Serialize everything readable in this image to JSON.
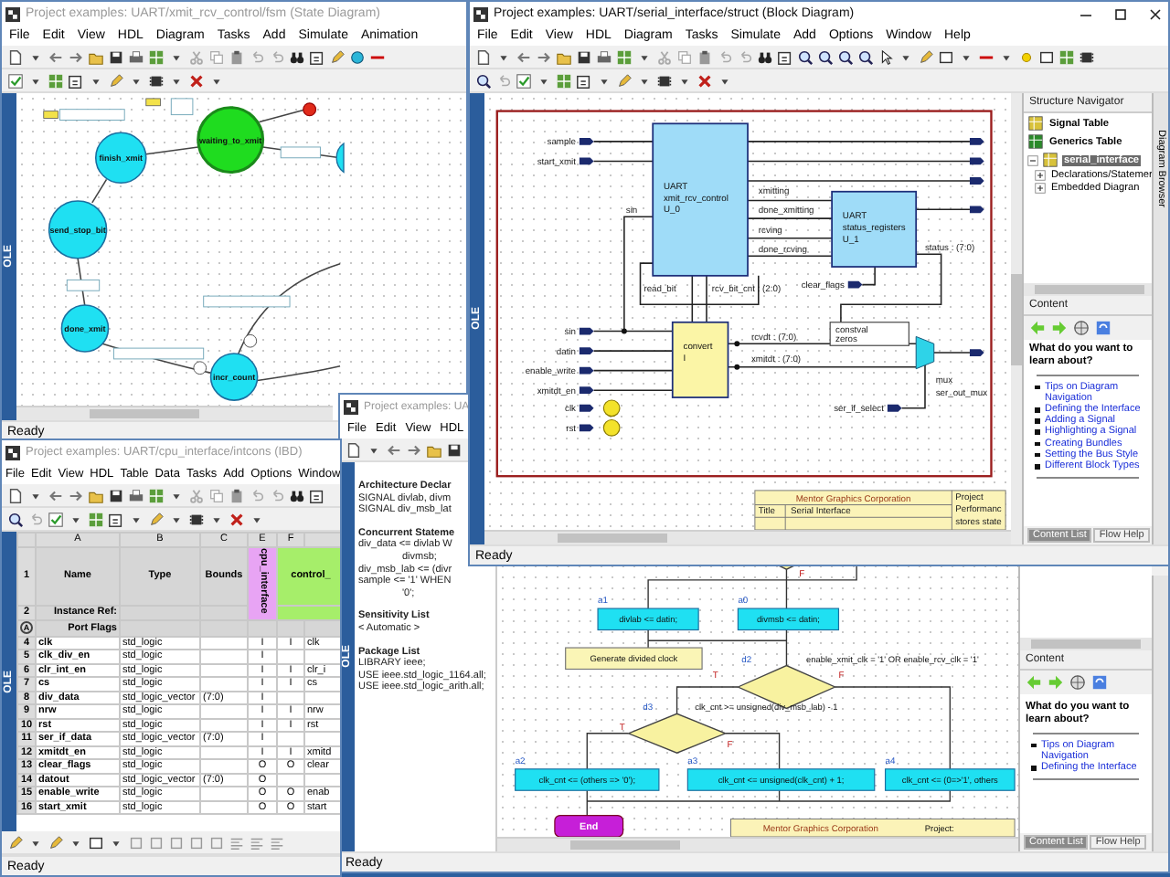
{
  "state_window": {
    "title": "Project examples: UART/xmit_rcv_control/fsm (State Diagram)",
    "menu": [
      "File",
      "Edit",
      "View",
      "HDL",
      "Diagram",
      "Tasks",
      "Add",
      "Simulate",
      "Animation"
    ],
    "side_tab": "OLE",
    "states": [
      {
        "name": "waiting_to_xmit",
        "active": true
      },
      {
        "name": "finish_xmit",
        "active": false
      },
      {
        "name": "send_stop_bit",
        "active": false
      },
      {
        "name": "done_xmit",
        "active": false
      },
      {
        "name": "incr_count",
        "active": false
      }
    ],
    "status": "Ready"
  },
  "block_window": {
    "title": "Project examples: UART/serial_interface/struct (Block Diagram)",
    "menu": [
      "File",
      "Edit",
      "View",
      "HDL",
      "Diagram",
      "Tasks",
      "Simulate",
      "Add",
      "Options",
      "Window",
      "Help"
    ],
    "side_tab": "OLE",
    "ports": [
      "sample",
      "start_xmit",
      "sin",
      "datin",
      "enable_write",
      "xmitdt_en",
      "clk",
      "rst",
      "clear_flags",
      "ser_if_select"
    ],
    "blocks": [
      {
        "kind": "component",
        "lines": [
          "UART",
          "xmit_rcv_control",
          "U_0"
        ]
      },
      {
        "kind": "component",
        "lines": [
          "UART",
          "status_registers",
          "U_1"
        ]
      },
      {
        "kind": "embedded",
        "lines": [
          "convert",
          "I"
        ]
      }
    ],
    "signals": [
      "xmitting",
      "done_xmitting",
      "rcving",
      "done_rcving",
      "sin",
      "read_bit",
      "rcv_bit_cnt : (2:0)",
      "status : (7:0)",
      "rcvdt : (7:0)",
      "xmitdt : (7:0)",
      "mux",
      "ser_out_mux"
    ],
    "constant": [
      "constval",
      "zeros"
    ],
    "title_block": {
      "company": "Mentor Graphics Corporation",
      "title_label": "Title",
      "title": "Serial Interface",
      "project_label": "Project",
      "fields": [
        "Performanc",
        "stores state"
      ]
    },
    "navigator": {
      "title": "Structure Navigator",
      "items": [
        {
          "label": "Signal Table",
          "selected": false
        },
        {
          "label": "Generics Table",
          "selected": false
        },
        {
          "label": "serial_interface",
          "selected": true,
          "children": [
            {
              "label": "Declarations/Statemer"
            },
            {
              "label": "Embedded Diagran"
            }
          ]
        }
      ]
    },
    "browser_tab": "Diagram Browser",
    "help": {
      "title": "Content",
      "question": "What do you want to learn about?",
      "links": [
        "Tips on Diagram Navigation",
        "Defining the Interface",
        "Adding a Signal",
        "Highlighting a Signal",
        "Creating Bundles",
        "Setting the Bus Style",
        "Different Block Types"
      ],
      "tabs": [
        {
          "label": "Content List",
          "selected": true
        },
        {
          "label": "Flow Help",
          "selected": false
        }
      ]
    },
    "status": "Ready"
  },
  "flow_window": {
    "title": "Project examples: UA",
    "menu": [
      "File",
      "Edit",
      "View",
      "HDL"
    ],
    "side_tab": "OLE",
    "declarations": [
      {
        "kind": "heading",
        "text": "Architecture Declar"
      },
      {
        "kind": "code",
        "text": "SIGNAL divlab, divm"
      },
      {
        "kind": "code",
        "text": "SIGNAL div_msb_lat"
      },
      {
        "kind": "heading",
        "text": "Concurrent Stateme"
      },
      {
        "kind": "code",
        "text": "div_data <= divlab W"
      },
      {
        "kind": "cont",
        "text": "divmsb;"
      },
      {
        "kind": "code",
        "text": "div_msb_lab <= (divr"
      },
      {
        "kind": "code",
        "text": "sample <= '1' WHEN"
      },
      {
        "kind": "cont",
        "text": "'0';"
      },
      {
        "kind": "heading",
        "text": "Sensitivity List"
      },
      {
        "kind": "code",
        "text": "< Automatic >"
      },
      {
        "kind": "heading",
        "text": "Package List"
      },
      {
        "kind": "code",
        "text": "LIBRARY ieee;"
      },
      {
        "kind": "code",
        "text": "USE ieee.std_logic_1164.all;"
      },
      {
        "kind": "code",
        "text": "USE ieee.std_logic_arith.all;"
      }
    ],
    "actions": [
      {
        "label": "a1",
        "text": "divlab <= datin;"
      },
      {
        "label": "a0",
        "text": "divmsb <= datin;"
      },
      {
        "label": "a2",
        "text": "clk_cnt <= (others => '0');"
      },
      {
        "label": "a3",
        "text": "clk_cnt <= unsigned(clk_cnt) + 1;"
      },
      {
        "label": "a4",
        "text": "clk_cnt <= (0=>'1', others"
      }
    ],
    "comment": "Generate divided clock",
    "decisions": [
      {
        "label": "d2",
        "condition": "enable_xmit_clk = '1' OR enable_rcv_clk = '1'"
      },
      {
        "label": "d3",
        "condition": "clk_cnt >= unsigned(div_msb_lab) - 1"
      }
    ],
    "branch_labels": [
      "F",
      "T",
      "F",
      "T",
      "F"
    ],
    "end": "End",
    "title_block": {
      "company": "Mentor Graphics Corporation",
      "project": "Project:"
    },
    "help": {
      "title": "Content",
      "question": "What do you want to learn about?",
      "links": [
        "Tips on Diagram Navigation",
        "Defining the Interface"
      ],
      "tabs": [
        {
          "label": "Content List",
          "selected": true
        },
        {
          "label": "Flow Help",
          "selected": false
        }
      ]
    },
    "status": "Ready"
  },
  "ibd_window": {
    "title": "Project examples: UART/cpu_interface/intcons (IBD)",
    "menu": [
      "File",
      "Edit",
      "View",
      "HDL",
      "Table",
      "Data",
      "Tasks",
      "Add",
      "Options",
      "Window"
    ],
    "side_tab": "OLE",
    "column_letters": [
      "A",
      "B",
      "C",
      "E",
      "F"
    ],
    "header_rows": [
      "1",
      "2"
    ],
    "headers": [
      "Name",
      "Type",
      "Bounds"
    ],
    "instances": [
      {
        "name": "cpu_interface",
        "color": "#e8a4f4"
      },
      {
        "name": "control_",
        "color": "#a6ee6a"
      }
    ],
    "instance_ref_label": "Instance Ref:",
    "flags_row_marker": "A",
    "port_flags_label": "Port Flags",
    "rows": [
      {
        "num": "4",
        "name": "clk",
        "type": "std_logic",
        "e": "I",
        "f": "I",
        "g": "clk"
      },
      {
        "num": "5",
        "name": "clk_div_en",
        "type": "std_logic",
        "e": "I"
      },
      {
        "num": "6",
        "name": "clr_int_en",
        "type": "std_logic",
        "e": "I",
        "f": "I",
        "g": "clr_i"
      },
      {
        "num": "7",
        "name": "cs",
        "type": "std_logic",
        "e": "I",
        "f": "I",
        "g": "cs"
      },
      {
        "num": "8",
        "name": "div_data",
        "type": "std_logic_vector",
        "bounds": "(7:0)",
        "e": "I"
      },
      {
        "num": "9",
        "name": "nrw",
        "type": "std_logic",
        "e": "I",
        "f": "I",
        "g": "nrw"
      },
      {
        "num": "10",
        "name": "rst",
        "type": "std_logic",
        "e": "I",
        "f": "I",
        "g": "rst"
      },
      {
        "num": "11",
        "name": "ser_if_data",
        "type": "std_logic_vector",
        "bounds": "(7:0)",
        "e": "I"
      },
      {
        "num": "12",
        "name": "xmitdt_en",
        "type": "std_logic",
        "e": "I",
        "f": "I",
        "g": "xmitd"
      },
      {
        "num": "13",
        "name": "clear_flags",
        "type": "std_logic",
        "e": "O",
        "f": "O",
        "g": "clear"
      },
      {
        "num": "14",
        "name": "datout",
        "type": "std_logic_vector",
        "bounds": "(7:0)",
        "e": "O"
      },
      {
        "num": "15",
        "name": "enable_write",
        "type": "std_logic",
        "e": "O",
        "f": "O",
        "g": "enab"
      },
      {
        "num": "16",
        "name": "start_xmit",
        "type": "std_logic",
        "e": "O",
        "f": "O",
        "g": "start"
      }
    ],
    "status": "Ready"
  }
}
